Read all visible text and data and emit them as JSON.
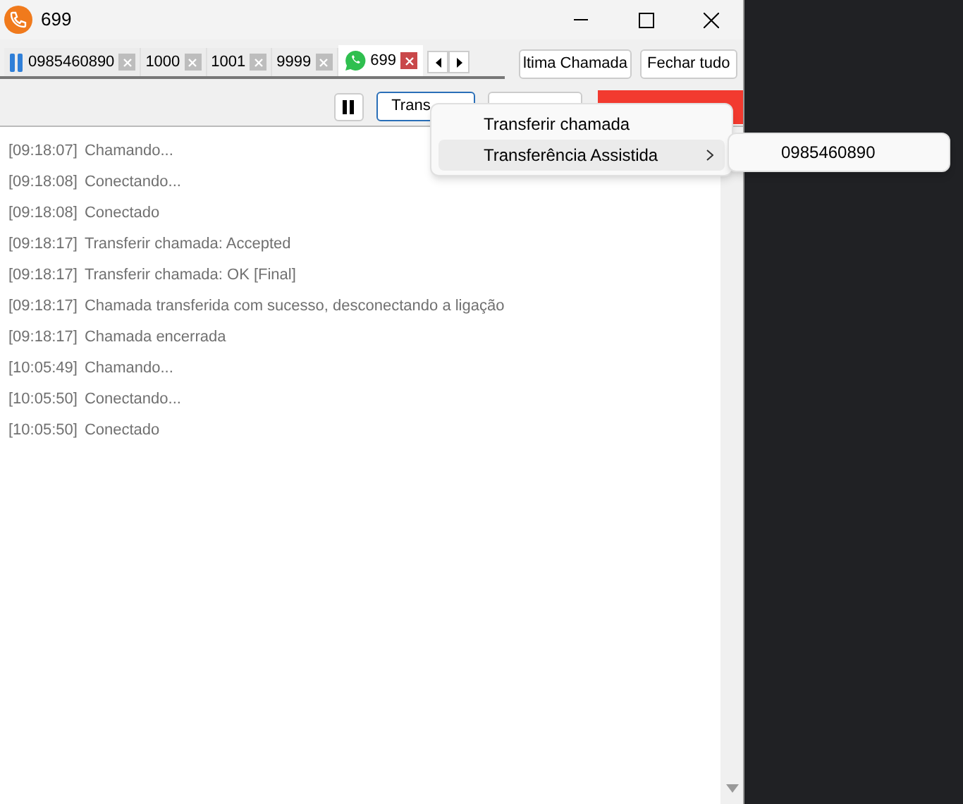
{
  "window": {
    "title": "699"
  },
  "tabs": [
    {
      "label": "0985460890",
      "selected": false,
      "kind": "paused"
    },
    {
      "label": "1000",
      "selected": false,
      "kind": "plain"
    },
    {
      "label": "1001",
      "selected": false,
      "kind": "plain"
    },
    {
      "label": "9999",
      "selected": false,
      "kind": "plain"
    },
    {
      "label": "699",
      "selected": true,
      "kind": "whatsapp"
    }
  ],
  "header_buttons": [
    "ltima Chamada",
    "Fechar tudo"
  ],
  "toolbar": [
    {
      "kind": "pause"
    },
    {
      "kind": "outline",
      "label": "Trans",
      "focused": true
    },
    {
      "kind": "outline"
    },
    {
      "kind": "danger"
    }
  ],
  "menu": {
    "items": [
      {
        "label": "Transferir chamada",
        "selected": false,
        "has_submenu": false
      },
      {
        "label": "Transferência Assistida",
        "selected": true,
        "has_submenu": true
      }
    ],
    "submenu": [
      "0985460890"
    ]
  },
  "log": [
    {
      "time": "[09:18:07]",
      "text": "Chamando..."
    },
    {
      "time": "[09:18:08]",
      "text": "Conectando..."
    },
    {
      "time": "[09:18:08]",
      "text": "Conectado"
    },
    {
      "time": "[09:18:17]",
      "text": "Transferir chamada: Accepted"
    },
    {
      "time": "[09:18:17]",
      "text": "Transferir chamada: OK [Final]"
    },
    {
      "time": "[09:18:17]",
      "text": "Chamada transferida com sucesso, desconectando a ligação"
    },
    {
      "time": "[09:18:17]",
      "text": "Chamada encerrada"
    },
    {
      "time": "[10:05:49]",
      "text": "Chamando..."
    },
    {
      "time": "[10:05:50]",
      "text": "Conectando..."
    },
    {
      "time": "[10:05:50]",
      "text": "Conectado"
    }
  ]
}
